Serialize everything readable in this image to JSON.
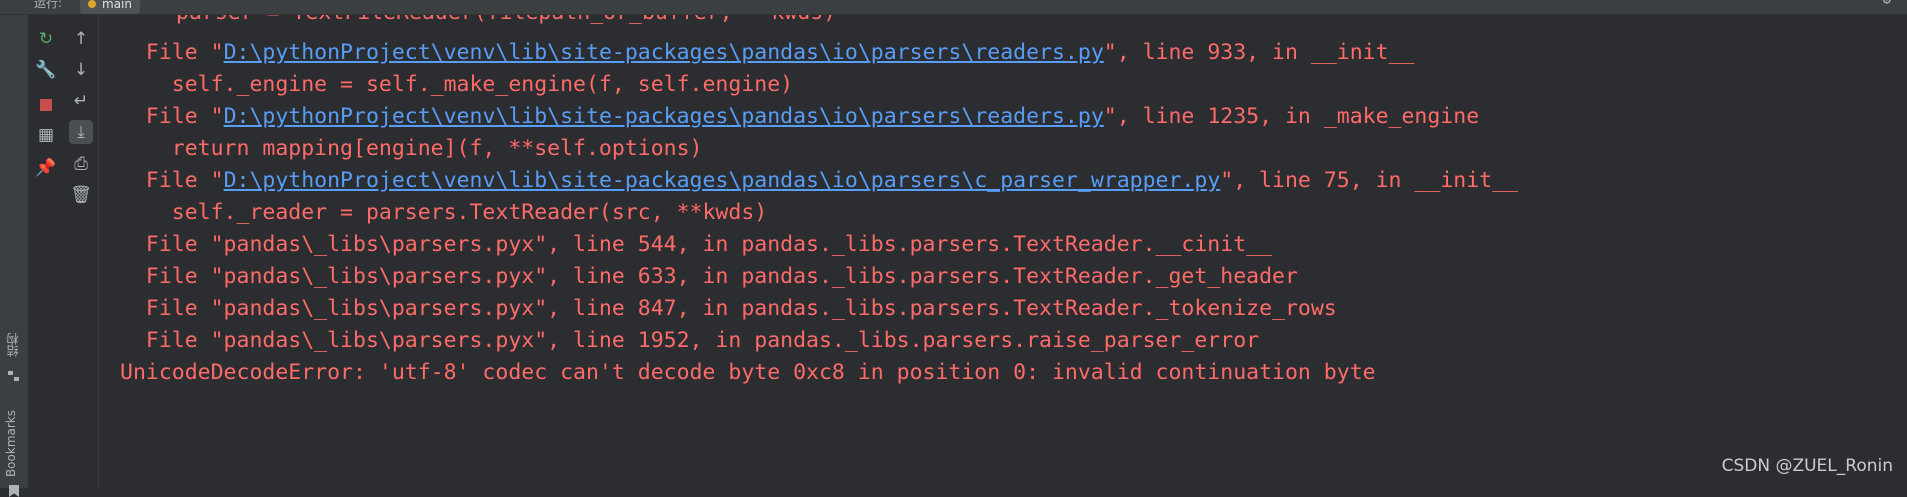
{
  "window": {
    "run_label": "运行:",
    "tab_name": "main"
  },
  "left_strip": {
    "structure_label": "结构",
    "bookmarks_label": "Bookmarks"
  },
  "console": {
    "cut_line": "parser = TextFileReader(filepath_or_buffer, **kwds)",
    "lines": [
      {
        "pre": "  File \"",
        "link": "D:\\pythonProject\\venv\\lib\\site-packages\\pandas\\io\\parsers\\readers.py",
        "post": "\", line 933, in __init__"
      },
      {
        "text": "    self._engine = self._make_engine(f, self.engine)"
      },
      {
        "pre": "  File \"",
        "link": "D:\\pythonProject\\venv\\lib\\site-packages\\pandas\\io\\parsers\\readers.py",
        "post": "\", line 1235, in _make_engine"
      },
      {
        "text": "    return mapping[engine](f, **self.options)"
      },
      {
        "pre": "  File \"",
        "link": "D:\\pythonProject\\venv\\lib\\site-packages\\pandas\\io\\parsers\\c_parser_wrapper.py",
        "post": "\", line 75, in __init__"
      },
      {
        "text": "    self._reader = parsers.TextReader(src, **kwds)"
      },
      {
        "text": "  File \"pandas\\_libs\\parsers.pyx\", line 544, in pandas._libs.parsers.TextReader.__cinit__"
      },
      {
        "text": "  File \"pandas\\_libs\\parsers.pyx\", line 633, in pandas._libs.parsers.TextReader._get_header"
      },
      {
        "text": "  File \"pandas\\_libs\\parsers.pyx\", line 847, in pandas._libs.parsers.TextReader._tokenize_rows"
      },
      {
        "text": "  File \"pandas\\_libs\\parsers.pyx\", line 1952, in pandas._libs.parsers.raise_parser_error"
      },
      {
        "text": "UnicodeDecodeError: 'utf-8' codec can't decode byte 0xc8 in position 0: invalid continuation byte"
      }
    ]
  },
  "watermark": "CSDN @ZUEL_Ronin",
  "colors": {
    "error_text": "#ff6b68",
    "link": "#589df6",
    "background": "#2b2d30"
  },
  "icons": {
    "col1": [
      "rerun-icon",
      "wrench-icon",
      "stop-icon",
      "layout-icon",
      "pin-icon"
    ],
    "col2": [
      "arrow-up-icon",
      "arrow-down-icon",
      "soft-wrap-icon",
      "scroll-to-end-icon",
      "print-icon",
      "trash-icon"
    ]
  }
}
